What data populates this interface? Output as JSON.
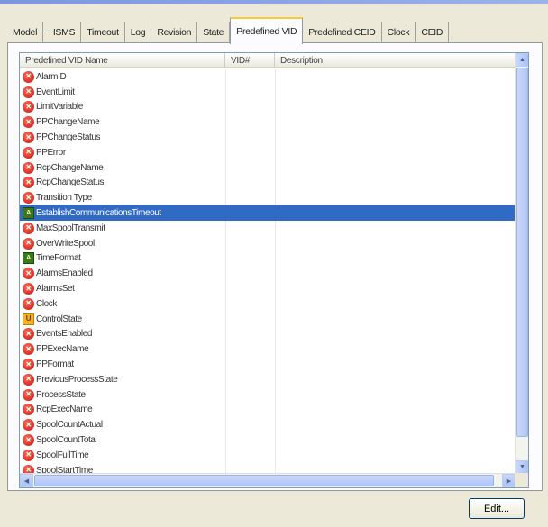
{
  "tabs": [
    {
      "label": "Model",
      "active": false
    },
    {
      "label": "HSMS",
      "active": false
    },
    {
      "label": "Timeout",
      "active": false
    },
    {
      "label": "Log",
      "active": false
    },
    {
      "label": "Revision",
      "active": false
    },
    {
      "label": "State",
      "active": false
    },
    {
      "label": "Predefined VID",
      "active": true
    },
    {
      "label": "Predefined CEID",
      "active": false
    },
    {
      "label": "Clock",
      "active": false
    },
    {
      "label": "CEID",
      "active": false
    }
  ],
  "list": {
    "columns": {
      "name": "Predefined VID Name",
      "vid": "VID#",
      "description": "Description"
    },
    "rows": [
      {
        "name": "AlarmID",
        "icon": "error-icon"
      },
      {
        "name": "EventLimit",
        "icon": "error-icon"
      },
      {
        "name": "LimitVariable",
        "icon": "error-icon"
      },
      {
        "name": "PPChangeName",
        "icon": "error-icon"
      },
      {
        "name": "PPChangeStatus",
        "icon": "error-icon"
      },
      {
        "name": "PPError",
        "icon": "error-icon"
      },
      {
        "name": "RcpChangeName",
        "icon": "error-icon"
      },
      {
        "name": "RcpChangeStatus",
        "icon": "error-icon"
      },
      {
        "name": "Transition Type",
        "icon": "error-icon"
      },
      {
        "name": "EstablishCommunicationsTimeout",
        "icon": "ascii-icon",
        "selected": true
      },
      {
        "name": "MaxSpoolTransmit",
        "icon": "error-icon"
      },
      {
        "name": "OverWriteSpool",
        "icon": "error-icon"
      },
      {
        "name": "TimeFormat",
        "icon": "ascii-icon"
      },
      {
        "name": "AlarmsEnabled",
        "icon": "error-icon"
      },
      {
        "name": "AlarmsSet",
        "icon": "error-icon"
      },
      {
        "name": "Clock",
        "icon": "error-icon"
      },
      {
        "name": "ControlState",
        "icon": "uint-icon"
      },
      {
        "name": "EventsEnabled",
        "icon": "error-icon"
      },
      {
        "name": "PPExecName",
        "icon": "error-icon"
      },
      {
        "name": "PPFormat",
        "icon": "error-icon"
      },
      {
        "name": "PreviousProcessState",
        "icon": "error-icon"
      },
      {
        "name": "ProcessState",
        "icon": "error-icon"
      },
      {
        "name": "RcpExecName",
        "icon": "error-icon"
      },
      {
        "name": "SpoolCountActual",
        "icon": "error-icon"
      },
      {
        "name": "SpoolCountTotal",
        "icon": "error-icon"
      },
      {
        "name": "SpoolFullTime",
        "icon": "error-icon"
      },
      {
        "name": "SpoolStartTime",
        "icon": "error-icon"
      }
    ]
  },
  "buttons": {
    "edit": "Edit..."
  },
  "icon_glyphs": {
    "error-icon": "✕",
    "ascii-icon": "A",
    "uint-icon": "U"
  },
  "colors": {
    "selection": "#316ac5",
    "error_icon": "#c8120a",
    "ascii_icon": "#3a7a1a",
    "uint_icon": "#f5b324",
    "active_tab_accent": "#ffc83c"
  }
}
